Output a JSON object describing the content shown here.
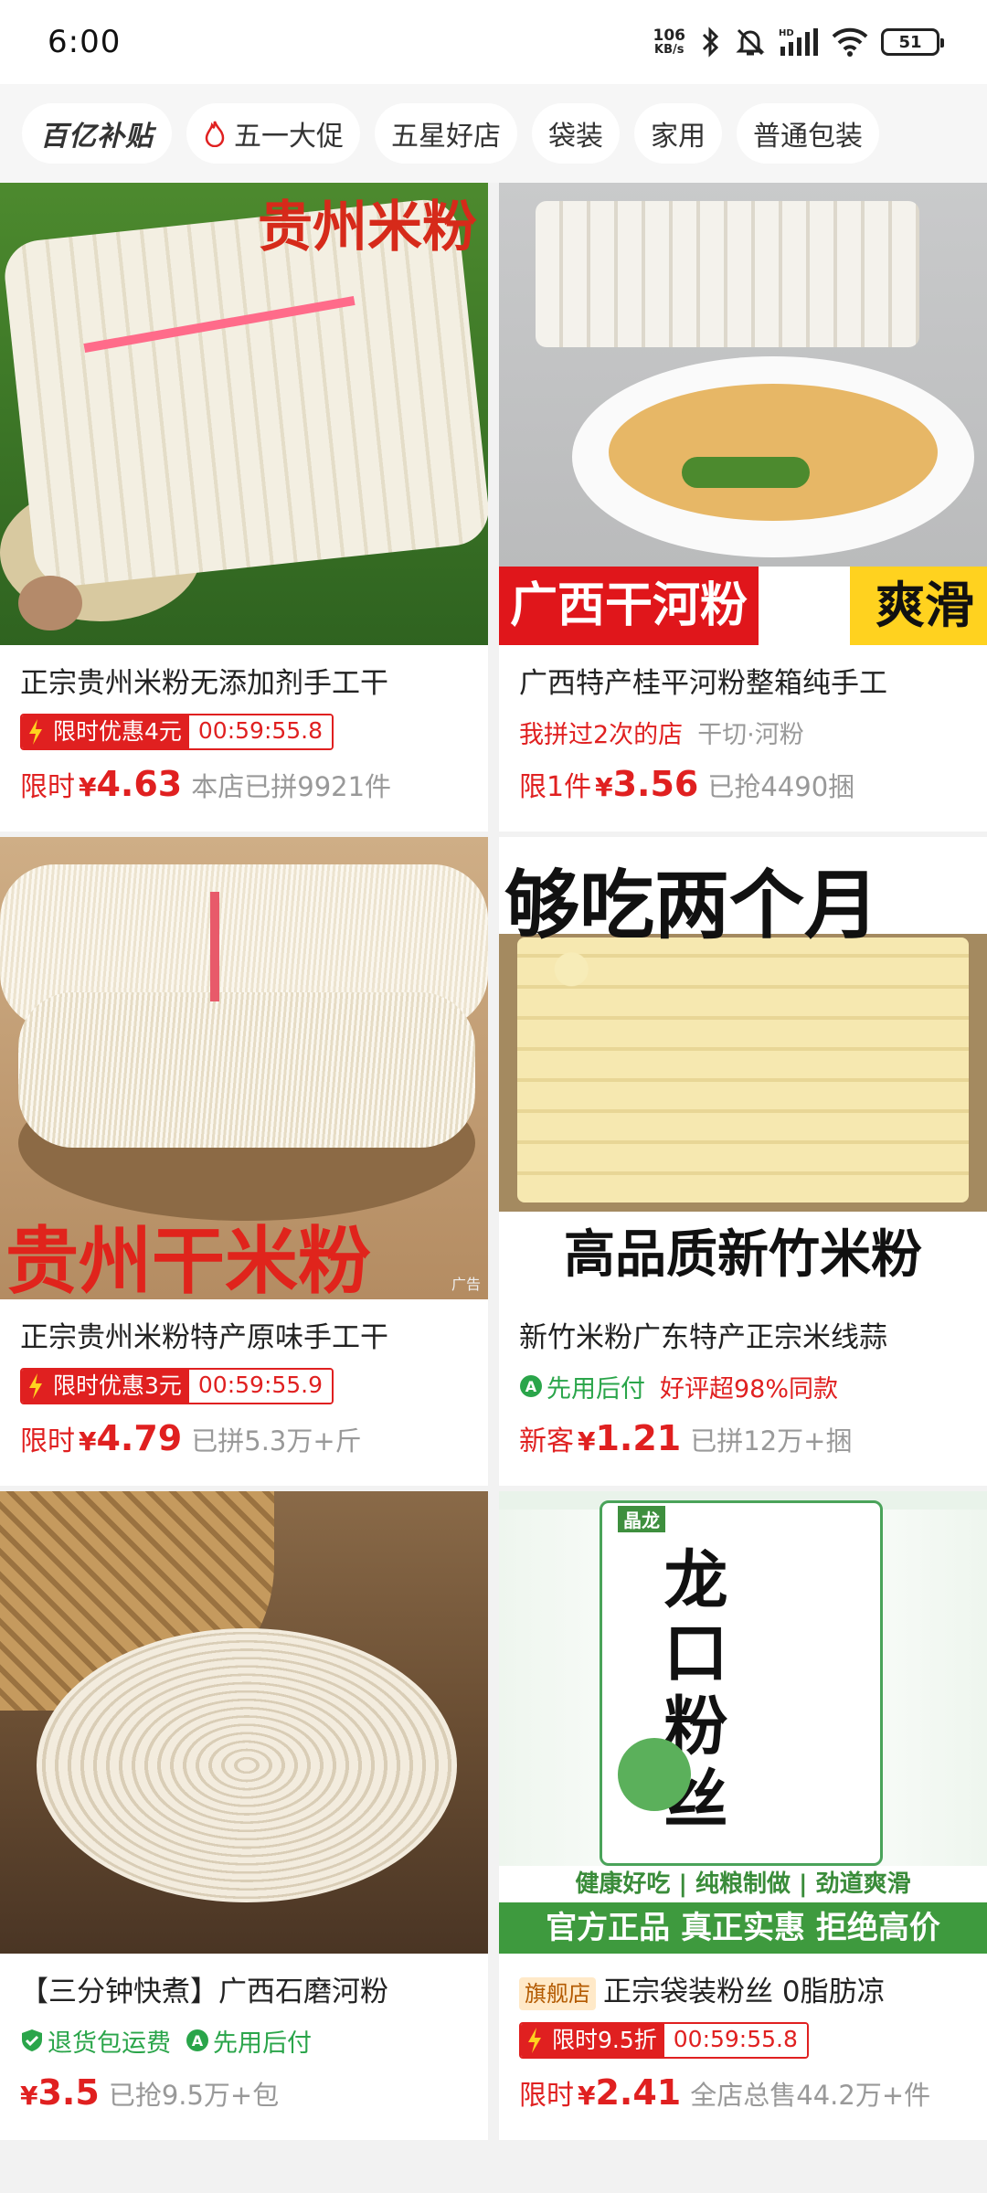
{
  "status": {
    "time": "6:00",
    "net_speed": "106",
    "net_unit": "KB/s",
    "hd": "HD",
    "battery": "51"
  },
  "filters": [
    {
      "label": "百亿补贴"
    },
    {
      "label": "五一大促",
      "icon": "flame-icon"
    },
    {
      "label": "五星好店"
    },
    {
      "label": "袋装"
    },
    {
      "label": "家用"
    },
    {
      "label": "普通包装"
    }
  ],
  "products": [
    {
      "image_text": "贵州米粉",
      "title": "正宗贵州米粉无添加剂手工干",
      "promo": {
        "label": "限时优惠4元",
        "timer": "00:59:55.8"
      },
      "price_label": "限时",
      "price": "4.63",
      "sold": "本店已拼9921件"
    },
    {
      "image_text": "广西干河粉",
      "image_text2": "爽滑",
      "title": "广西特产桂平河粉整箱纯手工",
      "tag1": "我拼过2次的店",
      "tag2": "干切·河粉",
      "price_label": "限1件",
      "price": "3.56",
      "sold": "已抢4490捆"
    },
    {
      "image_text": "贵州干米粉",
      "ad": "广告",
      "title": "正宗贵州米粉特产原味手工干",
      "promo": {
        "label": "限时优惠3元",
        "timer": "00:59:55.9"
      },
      "price_label": "限时",
      "price": "4.79",
      "sold": "已拼5.3万+斤"
    },
    {
      "image_text": "够吃两个月",
      "image_text2": "高品质新竹米粉",
      "title": "新竹米粉广东特产正宗米线蒜",
      "tag1": "先用后付",
      "tag2": "好评超98%同款",
      "price_label": "新客",
      "price": "1.21",
      "sold": "已拼12万+捆"
    },
    {
      "title": "【三分钟快煮】广西石磨河粉",
      "tag1": "退货包运费",
      "tag2": "先用后付",
      "price_label": "",
      "price": "3.5",
      "sold": "已抢9.5万+包"
    },
    {
      "image_text": "龙口粉丝",
      "image_brand": "晶龙",
      "image_bar1": "健康好吃 | 纯粮制做 | 劲道爽滑",
      "image_bar2": "官方正品  真正实惠  拒绝高价",
      "flagship": "旗舰店",
      "title": "正宗袋装粉丝 0脂肪凉",
      "promo": {
        "label": "限时9.5折",
        "timer": "00:59:55.8"
      },
      "price_label": "限时",
      "price": "2.41",
      "sold": "全店总售44.2万+件"
    }
  ],
  "currency": "¥",
  "colors": {
    "accent": "#e02020",
    "green": "#2aa54a"
  }
}
